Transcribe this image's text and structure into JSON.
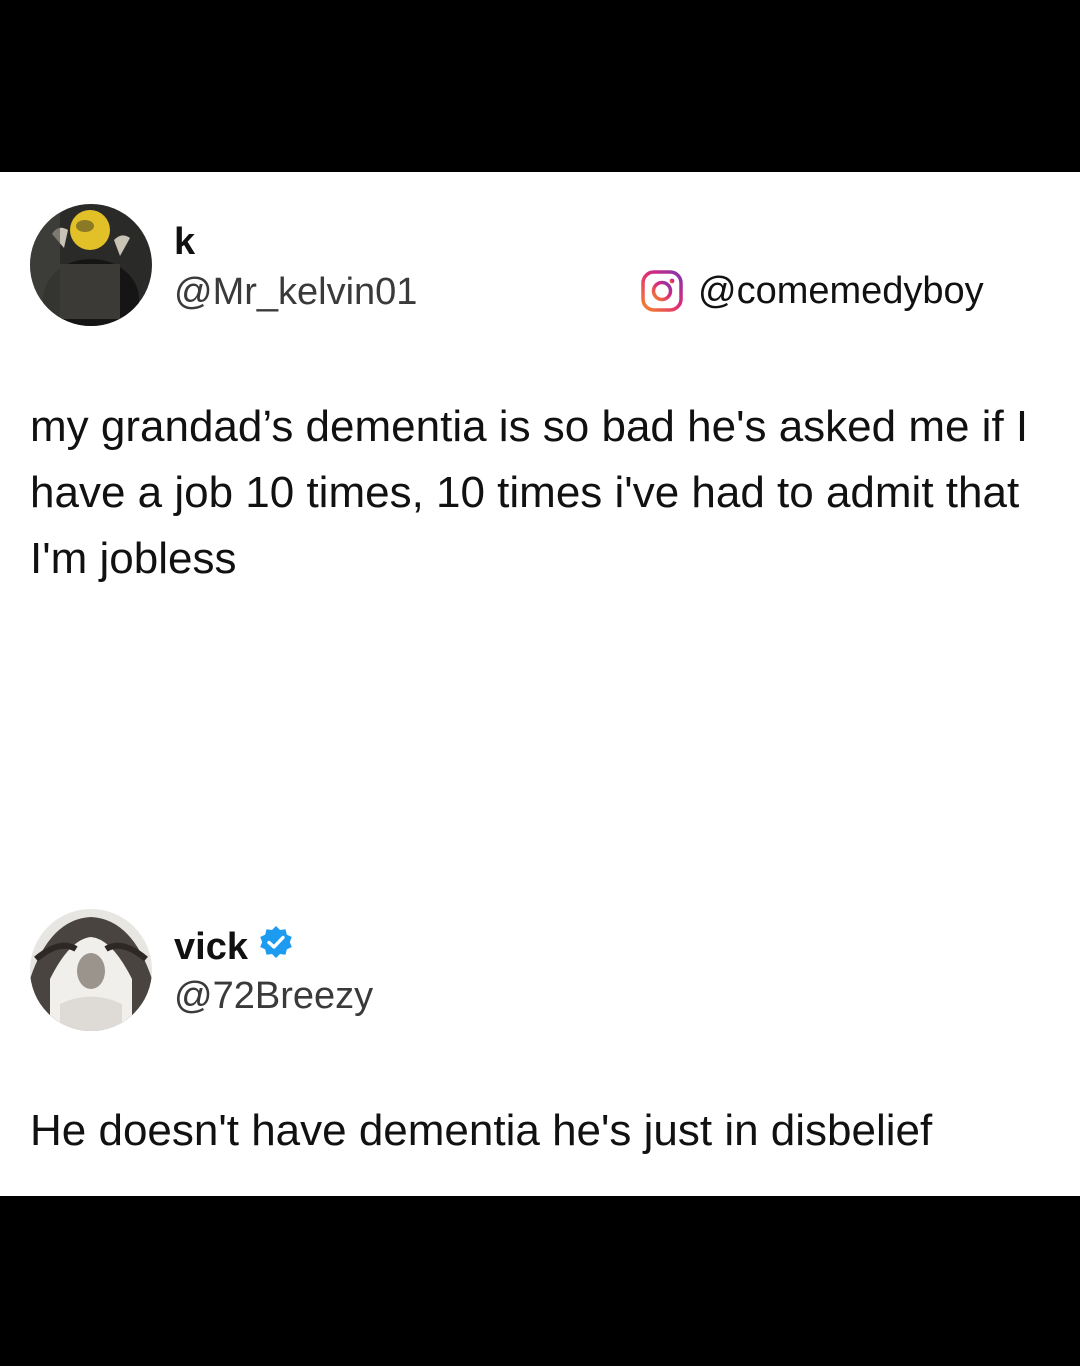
{
  "tweet": {
    "display_name": "k",
    "handle": "@Mr_kelvin01",
    "text": "my grandad’s dementia is so bad he's asked me if I have a job 10 times, 10 times i've had to admit that I'm jobless"
  },
  "watermark": {
    "icon": "instagram-icon",
    "handle": "@comemedyboy"
  },
  "reply": {
    "display_name": "vick",
    "verified": true,
    "handle": "@72Breezy",
    "text": "He doesn't have dementia he's just in disbelief"
  },
  "colors": {
    "verified_badge": "#1d9bf0",
    "instagram_gradient_start": "#f58529",
    "instagram_gradient_mid": "#dd2a7b",
    "instagram_gradient_end": "#8134af"
  }
}
